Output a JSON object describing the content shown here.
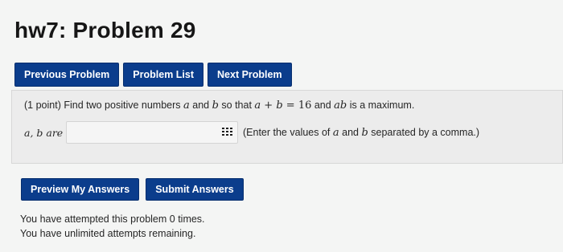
{
  "header": {
    "title": "hw7: Problem 29"
  },
  "nav": {
    "previous_label": "Previous Problem",
    "list_label": "Problem List",
    "next_label": "Next Problem"
  },
  "problem": {
    "points_text": "(1 point) Find two positive numbers ",
    "var_a": "a",
    "and_text": " and ",
    "var_b": "b",
    "so_text": " so that ",
    "eq_lhs": "a + b",
    "eq_sign": " = ",
    "eq_rhs": "16",
    "and_text2": " and ",
    "product": "ab",
    "max_text": " is a maximum.",
    "answer_label": "a, b are",
    "answer_value": "",
    "hint_prefix": "(Enter the values of ",
    "hint_a": "a",
    "hint_and": " and ",
    "hint_b": "b",
    "hint_suffix": " separated by a comma.)"
  },
  "actions": {
    "preview_label": "Preview My Answers",
    "submit_label": "Submit Answers"
  },
  "status": {
    "attempts_line": "You have attempted this problem 0 times.",
    "remaining_line": "You have unlimited attempts remaining."
  }
}
